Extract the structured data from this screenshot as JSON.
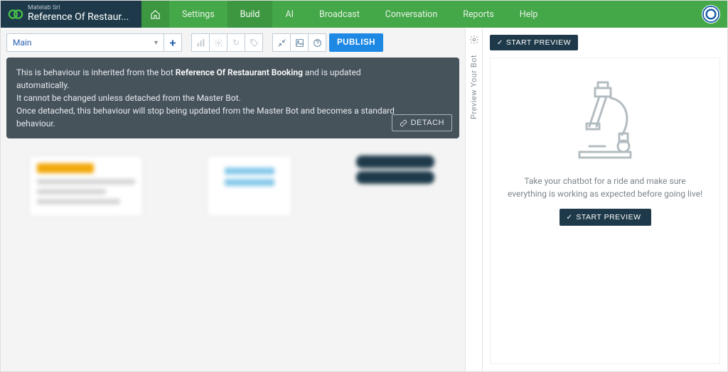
{
  "brand": {
    "org": "Matelab Srl",
    "title": "Reference Of Restaur..."
  },
  "nav": {
    "settings": "Settings",
    "build": "Build",
    "ai": "AI",
    "broadcast": "Broadcast",
    "conversation": "Conversation",
    "reports": "Reports",
    "help": "Help"
  },
  "toolbar": {
    "behaviour": "Main",
    "publish": "PUBLISH"
  },
  "notice": {
    "line1a": "This is behaviour is inherited from the bot ",
    "bot_name": "Reference Of Restaurant Booking",
    "line1b": " and is updated automatically.",
    "line2": "It cannot be changed unless detached from the Master Bot.",
    "line3": "Once detached, this behaviour will stop being updated from the Master Bot and becomes a standard behaviour.",
    "detach": "DETACH"
  },
  "preview": {
    "side_label": "Preview Your Bot",
    "start": "START PREVIEW",
    "desc": "Take your chatbot for a ride and make sure everything is working as expected before going live!"
  }
}
